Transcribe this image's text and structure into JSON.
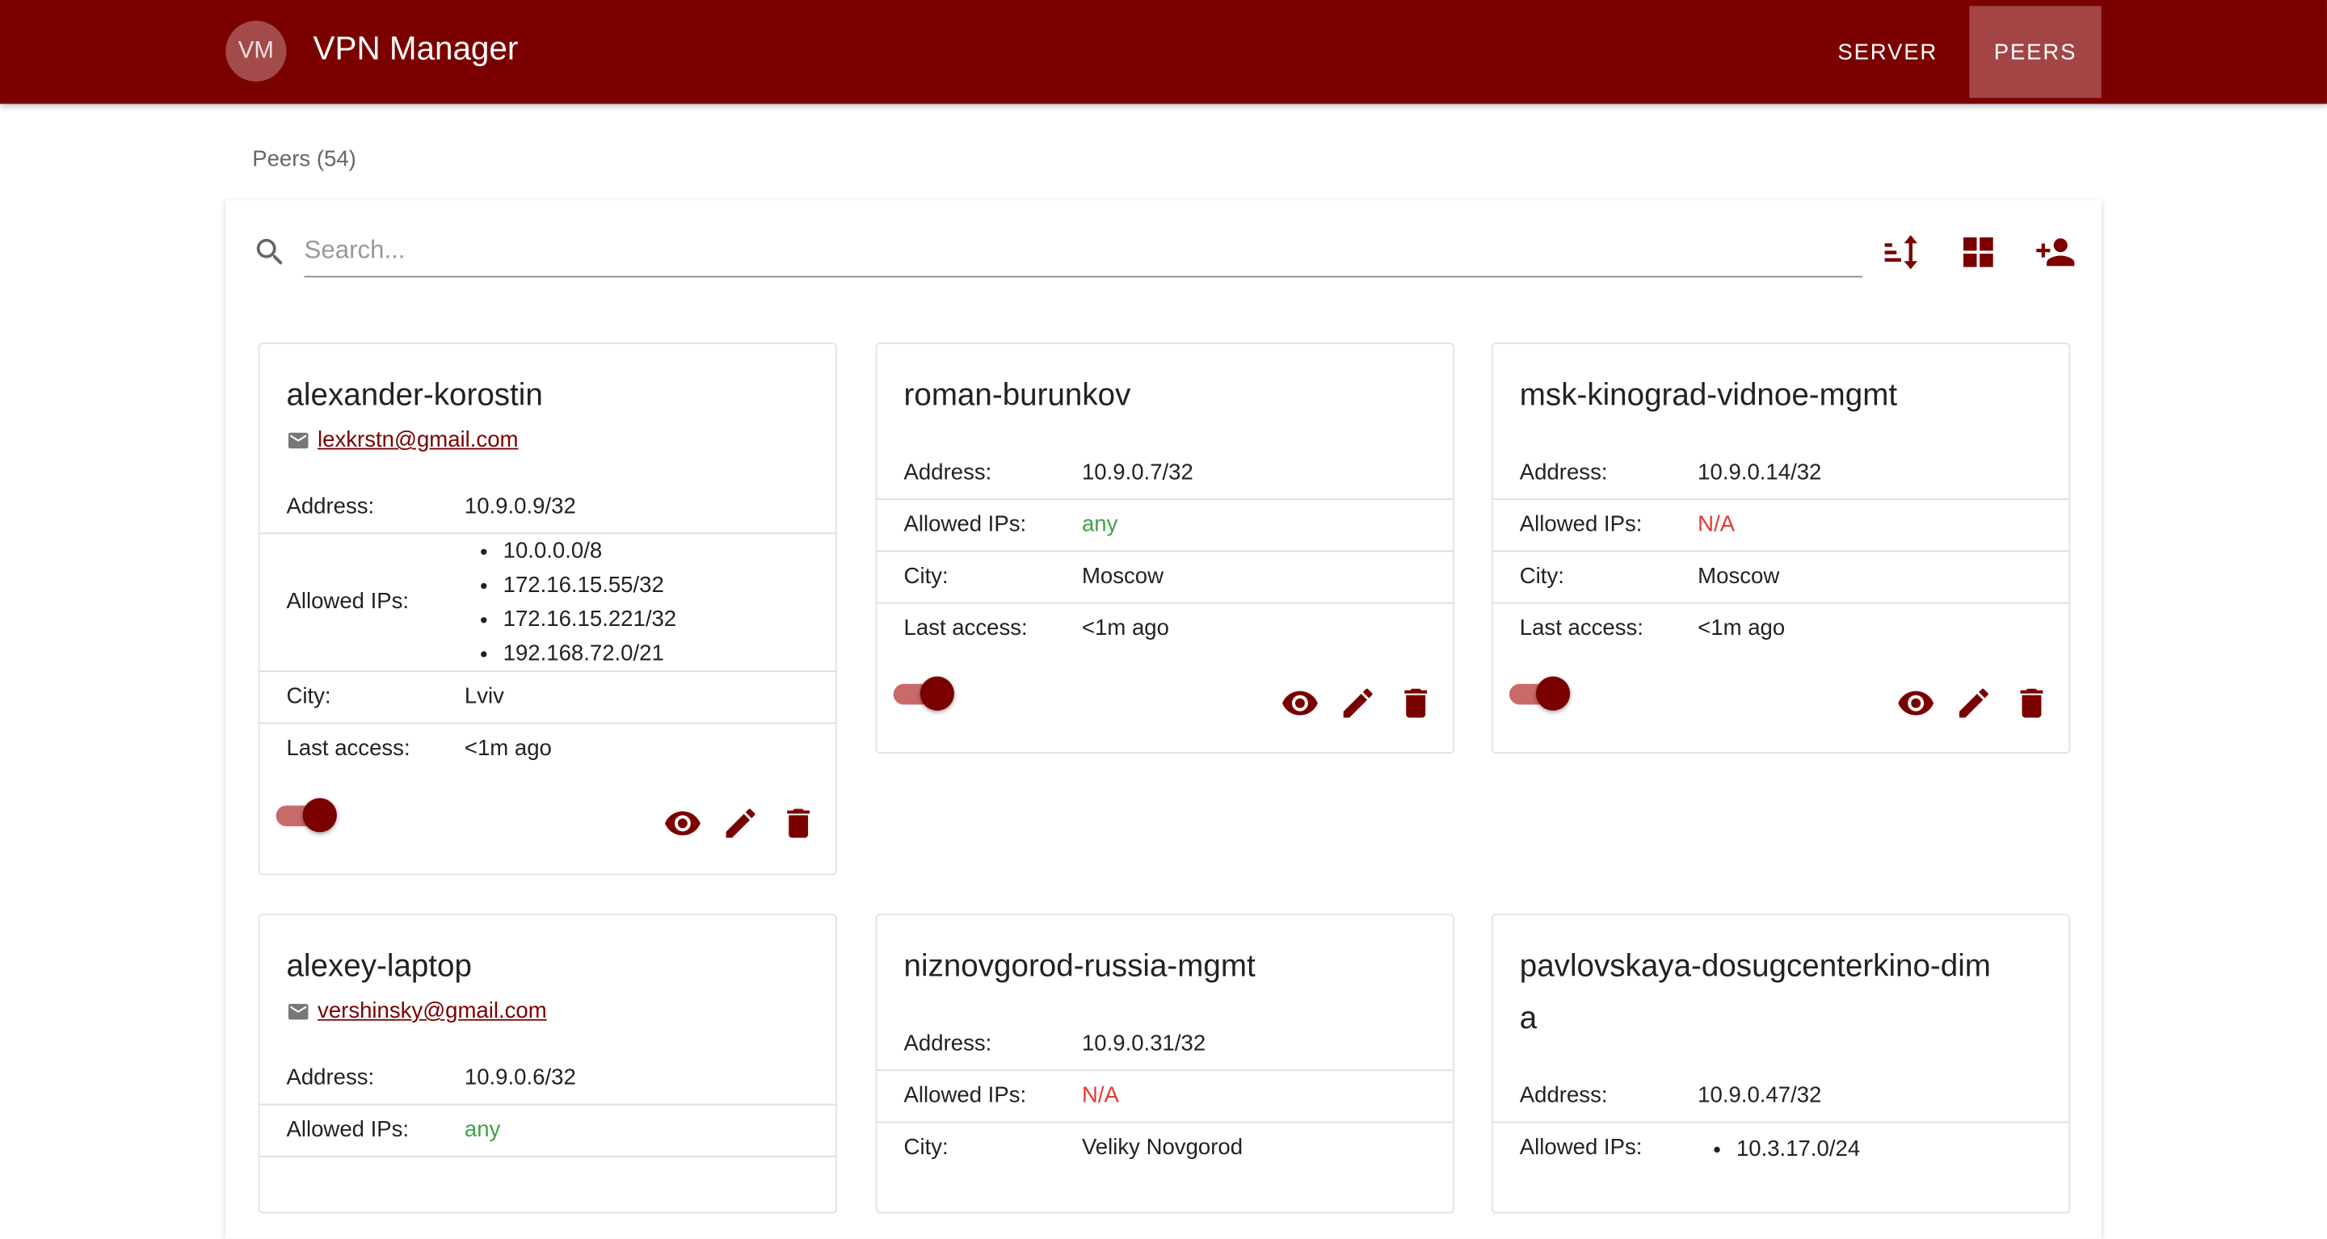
{
  "header": {
    "avatar_initials": "VM",
    "title": "VPN Manager",
    "nav": {
      "server": "SERVER",
      "peers": "PEERS",
      "active": "PEERS"
    }
  },
  "peers_count_label": "Peers (54)",
  "search": {
    "placeholder": "Search...",
    "value": ""
  },
  "toolbar": {
    "icons": [
      "sort-icon",
      "grid-view-icon",
      "add-person-icon"
    ]
  },
  "colors": {
    "primary": "#7b0000",
    "active_tab": "#a34545",
    "green": "#43a047",
    "red": "#e53935"
  },
  "labels": {
    "address": "Address:",
    "allowed_ips": "Allowed IPs:",
    "city": "City:",
    "last_access": "Last access:"
  },
  "cards": [
    {
      "name": "alexander-korostin",
      "email": "lexkrstn@gmail.com",
      "address": "10.9.0.9/32",
      "allowed_ips": [
        "10.0.0.0/8",
        "172.16.15.55/32",
        "172.16.15.221/32",
        "192.168.72.0/21"
      ],
      "city": "Lviv",
      "last_access": "<1m ago",
      "enabled": true
    },
    {
      "name": "roman-burunkov",
      "address": "10.9.0.7/32",
      "allowed_ips": "any",
      "city": "Moscow",
      "last_access": "<1m ago",
      "enabled": true
    },
    {
      "name": "msk-kinograd-vidnoe-mgmt",
      "address": "10.9.0.14/32",
      "allowed_ips": "N/A",
      "city": "Moscow",
      "last_access": "<1m ago",
      "enabled": true
    },
    {
      "name": "alexey-laptop",
      "email": "vershinsky@gmail.com",
      "address": "10.9.0.6/32",
      "allowed_ips": "any"
    },
    {
      "name": "niznovgorod-russia-mgmt",
      "address": "10.9.0.31/32",
      "allowed_ips": "N/A",
      "city": "Veliky Novgorod"
    },
    {
      "name_line1": "pavlovskaya-dosugcenterkino-dim",
      "name_line2": "a",
      "address": "10.9.0.47/32",
      "allowed_ips": [
        "10.3.17.0/24"
      ]
    }
  ]
}
